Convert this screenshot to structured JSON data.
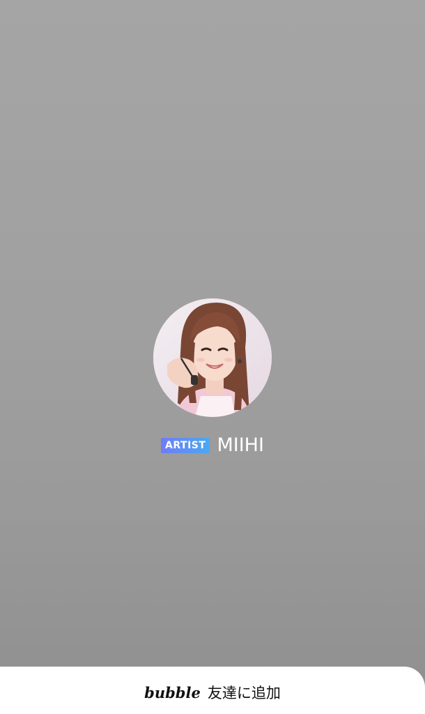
{
  "profile": {
    "badge": "ARTIST",
    "name": "MIIHI",
    "avatar_icon": "artist-photo"
  },
  "footer": {
    "logo": "bubble",
    "action_label": "友達に追加"
  },
  "colors": {
    "background": "#a2a2a2",
    "badge_start": "#6f7cf6",
    "badge_end": "#4aa9f2",
    "sheet": "#ffffff"
  }
}
